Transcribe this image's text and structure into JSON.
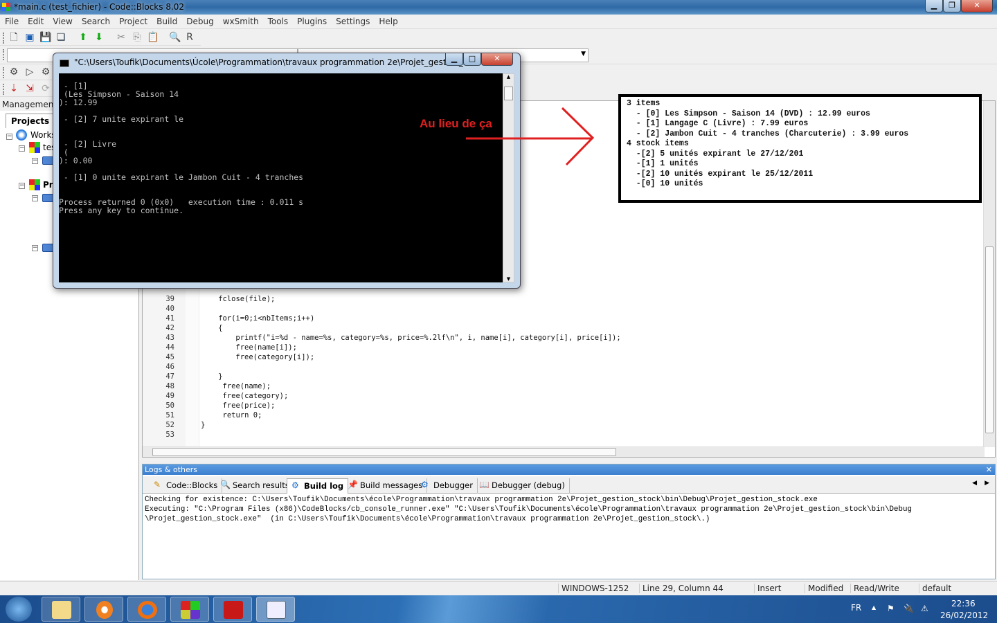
{
  "window": {
    "title": "*main.c (test_fichier) - Code::Blocks 8.02",
    "minimize": "▁",
    "maximize": "❐",
    "close": "✕"
  },
  "menu": [
    "File",
    "Edit",
    "View",
    "Search",
    "Project",
    "Build",
    "Debug",
    "wxSmith",
    "Tools",
    "Plugins",
    "Settings",
    "Help"
  ],
  "management": {
    "title": "Management",
    "tab": "Projects",
    "tree": [
      "Works",
      "tes",
      "Pr"
    ]
  },
  "editor": {
    "lines": [
      {
        "n": "39",
        "code": "fclose(file);",
        "indent": "    "
      },
      {
        "n": "40",
        "code": "",
        "indent": ""
      },
      {
        "n": "41",
        "code": "for(i=0;i<nbItems;i++)",
        "indent": "    "
      },
      {
        "n": "42",
        "code": "{",
        "indent": "    "
      },
      {
        "n": "43",
        "code": "printf(\"i=%d - name=%s, category=%s, price=%.2lf\\n\", i, name[i], category[i], price[i]);",
        "indent": "        "
      },
      {
        "n": "44",
        "code": "free(name[i]);",
        "indent": "        "
      },
      {
        "n": "45",
        "code": "free(category[i]);",
        "indent": "        "
      },
      {
        "n": "46",
        "code": "",
        "indent": ""
      },
      {
        "n": "47",
        "code": "}",
        "indent": "    "
      },
      {
        "n": "48",
        "code": "free(name);",
        "indent": "     "
      },
      {
        "n": "49",
        "code": "free(category);",
        "indent": "     "
      },
      {
        "n": "50",
        "code": "free(price);",
        "indent": "     "
      },
      {
        "n": "51",
        "code": "return 0;",
        "indent": "     "
      },
      {
        "n": "52",
        "code": "}",
        "indent": ""
      },
      {
        "n": "53",
        "code": "",
        "indent": ""
      }
    ]
  },
  "logs": {
    "title": "Logs & others",
    "tabs": [
      {
        "label": "Code::Blocks",
        "icon": "pencil-icon"
      },
      {
        "label": "Search results",
        "icon": "magnifier-icon"
      },
      {
        "label": "Build log",
        "icon": "gear-icon",
        "active": true
      },
      {
        "label": "Build messages",
        "icon": "pin-icon"
      },
      {
        "label": "Debugger",
        "icon": "gear-icon"
      },
      {
        "label": "Debugger (debug)",
        "icon": "book-icon"
      }
    ],
    "lines": [
      "Checking for existence: C:\\Users\\Toufik\\Documents\\école\\Programmation\\travaux programmation 2e\\Projet_gestion_stock\\bin\\Debug\\Projet_gestion_stock.exe",
      "Executing: \"C:\\Program Files (x86)\\CodeBlocks/cb_console_runner.exe\" \"C:\\Users\\Toufik\\Documents\\école\\Programmation\\travaux programmation 2e\\Projet_gestion_stock\\bin\\Debug",
      "\\Projet_gestion_stock.exe\"  (in C:\\Users\\Toufik\\Documents\\école\\Programmation\\travaux programmation 2e\\Projet_gestion_stock\\.)"
    ]
  },
  "status": {
    "encoding": "WINDOWS-1252",
    "position": "Line 29, Column 44",
    "mode": "Insert",
    "modified": "Modified",
    "access": "Read/Write",
    "profile": "default"
  },
  "console": {
    "title": "\"C:\\Users\\Toufik\\Documents\\Úcole\\Programmation\\travaux programmation 2e\\Projet_gestion_sto...",
    "lines": [
      " - [1]",
      " (Les Simpson - Saison 14",
      "): 12.99",
      "",
      " - [2] 7 unite expirant le",
      "",
      "",
      " - [2] Livre",
      " (",
      "): 0.00",
      "",
      " - [1] 0 unite expirant le Jambon Cuit - 4 tranches",
      "",
      "",
      "Process returned 0 (0x0)   execution time : 0.011 s",
      "Press any key to continue."
    ]
  },
  "annotation": {
    "label": "Au lieu de ça",
    "lines": [
      "3 items",
      "  - [0] Les Simpson - Saison 14 (DVD) : 12.99 euros",
      "  - [1] Langage C (Livre) : 7.99 euros",
      "  - [2] Jambon Cuit - 4 tranches (Charcuterie) : 3.99 euros",
      "4 stock items",
      "  -[2] 5 unités expirant le 27/12/201",
      "  -[1] 1 unités",
      "  -[2] 10 unités expirant le 25/12/2011",
      "  -[0] 10 unités"
    ],
    "color": "#e02020"
  },
  "taskbar": {
    "apps": [
      "explorer",
      "media-player",
      "firefox",
      "codeblocks",
      "acrobat",
      "console"
    ],
    "lang": "FR",
    "time": "22:36",
    "date": "26/02/2012"
  }
}
